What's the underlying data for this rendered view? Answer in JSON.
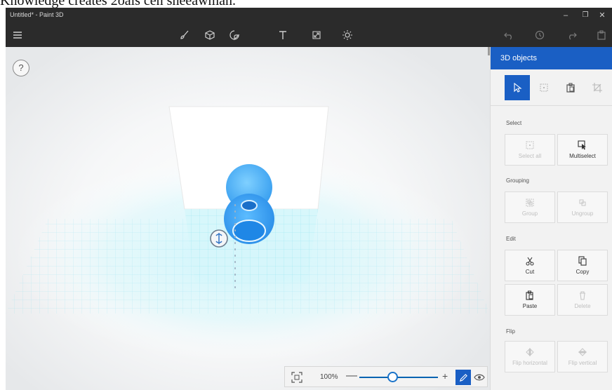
{
  "caption": "Knowledge creates 2oals cen sheeawman.",
  "window": {
    "title": "Untitled* - Paint 3D",
    "buttons": {
      "minimize": "–",
      "restore": "❐",
      "close": "✕"
    }
  },
  "toolbar": {
    "icons": [
      "menu-icon",
      "brush-icon",
      "cube-icon",
      "sticker-icon",
      "text-icon",
      "canvas-resize-icon",
      "effects-icon"
    ],
    "right_icons": [
      "undo-icon",
      "history-icon",
      "redo-icon",
      "paste-icon"
    ]
  },
  "canvas": {
    "help_label": "?"
  },
  "zoom": {
    "value": "100%",
    "minus": "—",
    "plus": "+",
    "level": 0.42
  },
  "panel": {
    "title": "3D objects",
    "tabs": [
      "select-tab",
      "3d-models-tab",
      "paste-tab",
      "crop-tab"
    ],
    "sections": {
      "select": {
        "label": "Select",
        "select_all": "Select all",
        "multiselect": "Multiselect"
      },
      "grouping": {
        "label": "Grouping",
        "group": "Group",
        "ungroup": "Ungroup"
      },
      "edit": {
        "label": "Edit",
        "cut": "Cut",
        "copy": "Copy",
        "paste": "Paste",
        "delete": "Delete"
      },
      "flip": {
        "label": "Flip",
        "flip_horizontal": "Flip horizontal",
        "flip_vertical": "Flip vertical"
      }
    }
  },
  "colors": {
    "accent": "#1a5fc4",
    "titlebar": "#2b2b2b",
    "object_blue": "#3aa0f0",
    "grid_cyan": "#8fe6f5"
  }
}
